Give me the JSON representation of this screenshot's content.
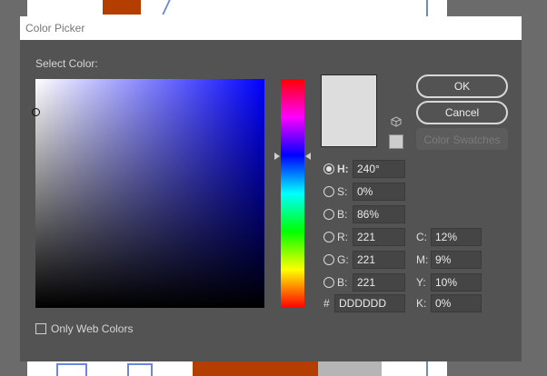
{
  "dialog": {
    "title": "Color Picker",
    "select_color_label": "Select Color:",
    "current_color": "#dddddd",
    "hue_base_color": "#0000ff"
  },
  "buttons": {
    "ok": "OK",
    "cancel": "Cancel",
    "swatches": "Color Swatches"
  },
  "hsb": [
    {
      "label": "H:",
      "value": "240°",
      "checked": true
    },
    {
      "label": "S:",
      "value": "0%",
      "checked": false
    },
    {
      "label": "B:",
      "value": "86%",
      "checked": false
    }
  ],
  "rgb": [
    {
      "label": "R:",
      "value": "221"
    },
    {
      "label": "G:",
      "value": "221"
    },
    {
      "label": "B:",
      "value": "221"
    }
  ],
  "cmyk": [
    {
      "label": "C:",
      "value": "12%"
    },
    {
      "label": "M:",
      "value": "9%"
    },
    {
      "label": "Y:",
      "value": "10%"
    },
    {
      "label": "K:",
      "value": "0%"
    }
  ],
  "hex": {
    "label": "#",
    "value": "DDDDDD"
  },
  "only_web_colors": {
    "label": "Only Web Colors",
    "checked": false
  },
  "icons": {
    "websafe_warning": "cube-icon"
  }
}
